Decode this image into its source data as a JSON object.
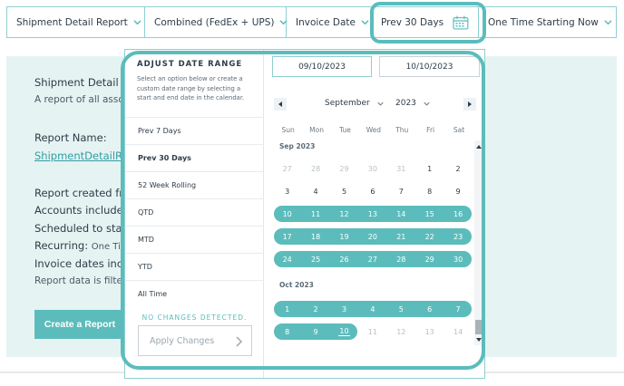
{
  "filter_bar": {
    "report": "Shipment Detail Report",
    "carriers": "Combined (FedEx + UPS)",
    "date_field": "Invoice Date",
    "date_range": "Prev 30 Days",
    "schedule": "One Time Starting Now"
  },
  "background": {
    "title": "Shipment Detail Re",
    "desc": "A report of all asso",
    "report_name_label": "Report Name:",
    "report_name_link": "ShipmentDetailRe",
    "created_from": "Report created from",
    "accounts": "Accounts included i",
    "scheduled": "Scheduled to start:",
    "recurring_label": "Recurring:",
    "recurring_value": "One Tim",
    "invoice_dates": "Invoice dates includ",
    "filter_note": "Report data is filter",
    "create_button": "Create a Report"
  },
  "panel": {
    "title": "ADJUST DATE RANGE",
    "description": "Select an option below or create a custom date range by selecting a start and end date in the calendar.",
    "options": [
      "Prev 7 Days",
      "Prev 30 Days",
      "52 Week Rolling",
      "QTD",
      "MTD",
      "YTD",
      "All Time"
    ],
    "selected_option": "Prev 30 Days",
    "status": "NO CHANGES DETECTED.",
    "apply_button": "Apply Changes",
    "start_date": "09/10/2023",
    "end_date": "10/10/2023"
  },
  "calendar": {
    "month": "September",
    "year": "2023",
    "weekdays": [
      "Sun",
      "Mon",
      "Tue",
      "Wed",
      "Thu",
      "Fri",
      "Sat"
    ],
    "months": [
      {
        "label": "Sep 2023",
        "weeks": [
          [
            {
              "d": "27",
              "t": "other"
            },
            {
              "d": "28",
              "t": "other"
            },
            {
              "d": "29",
              "t": "other"
            },
            {
              "d": "30",
              "t": "other"
            },
            {
              "d": "31",
              "t": "other"
            },
            {
              "d": "1",
              "t": "normal"
            },
            {
              "d": "2",
              "t": "normal"
            }
          ],
          [
            {
              "d": "3",
              "t": "normal"
            },
            {
              "d": "4",
              "t": "normal"
            },
            {
              "d": "5",
              "t": "normal"
            },
            {
              "d": "6",
              "t": "normal"
            },
            {
              "d": "7",
              "t": "normal"
            },
            {
              "d": "8",
              "t": "normal"
            },
            {
              "d": "9",
              "t": "normal"
            }
          ],
          [
            {
              "d": "10",
              "t": "range"
            },
            {
              "d": "11",
              "t": "range"
            },
            {
              "d": "12",
              "t": "range"
            },
            {
              "d": "13",
              "t": "range"
            },
            {
              "d": "14",
              "t": "range"
            },
            {
              "d": "15",
              "t": "range"
            },
            {
              "d": "16",
              "t": "range"
            }
          ],
          [
            {
              "d": "17",
              "t": "range"
            },
            {
              "d": "18",
              "t": "range"
            },
            {
              "d": "19",
              "t": "range"
            },
            {
              "d": "20",
              "t": "range"
            },
            {
              "d": "21",
              "t": "range"
            },
            {
              "d": "22",
              "t": "range"
            },
            {
              "d": "23",
              "t": "range"
            }
          ],
          [
            {
              "d": "24",
              "t": "range"
            },
            {
              "d": "25",
              "t": "range"
            },
            {
              "d": "26",
              "t": "range"
            },
            {
              "d": "27",
              "t": "range"
            },
            {
              "d": "28",
              "t": "range"
            },
            {
              "d": "29",
              "t": "range"
            },
            {
              "d": "30",
              "t": "range"
            }
          ]
        ]
      },
      {
        "label": "Oct 2023",
        "weeks": [
          [
            {
              "d": "1",
              "t": "range"
            },
            {
              "d": "2",
              "t": "range"
            },
            {
              "d": "3",
              "t": "range"
            },
            {
              "d": "4",
              "t": "range"
            },
            {
              "d": "5",
              "t": "range"
            },
            {
              "d": "6",
              "t": "range"
            },
            {
              "d": "7",
              "t": "range"
            }
          ],
          [
            {
              "d": "8",
              "t": "range"
            },
            {
              "d": "9",
              "t": "range"
            },
            {
              "d": "10",
              "t": "today"
            },
            {
              "d": "11",
              "t": "other"
            },
            {
              "d": "12",
              "t": "other"
            },
            {
              "d": "13",
              "t": "other"
            },
            {
              "d": "14",
              "t": "other"
            }
          ]
        ]
      }
    ]
  },
  "colors": {
    "accent": "#5cbcbc",
    "border": "#8ecfd0",
    "card_bg": "#e6f3f3",
    "text": "#2d3c48"
  }
}
